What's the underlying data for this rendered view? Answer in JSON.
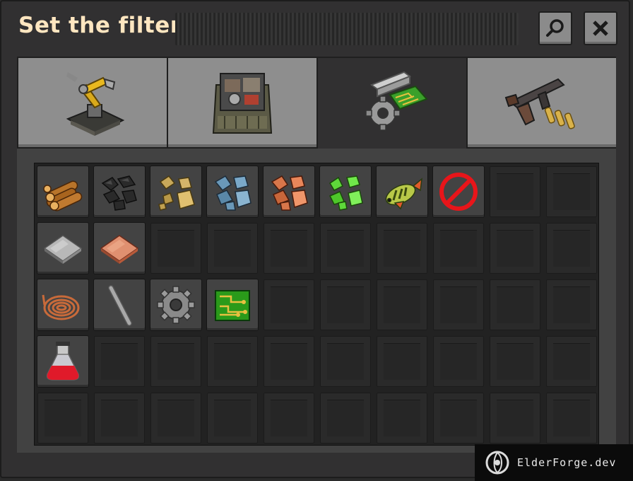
{
  "window": {
    "title": "Set the filter"
  },
  "toolbar": {
    "search_icon": "search-icon",
    "close_icon": "close-icon"
  },
  "tabs": [
    {
      "icon": "logistics-inserter-icon",
      "active": false
    },
    {
      "icon": "production-assembler-icon",
      "active": false
    },
    {
      "icon": "intermediate-products-icon",
      "active": true
    },
    {
      "icon": "combat-submachine-gun-icon",
      "active": false
    }
  ],
  "items": [
    [
      "wood",
      "coal",
      "stone",
      "iron-ore",
      "copper-ore",
      "uranium-ore",
      "raw-fish",
      "nothing"
    ],
    [
      "iron-plate",
      "copper-plate"
    ],
    [
      "copper-cable",
      "iron-stick",
      "iron-gear-wheel",
      "electronic-circuit"
    ],
    [
      "automation-science-pack"
    ]
  ],
  "grid": {
    "columns": 10,
    "rows": 5
  },
  "watermark": {
    "text": "ElderForge.dev"
  }
}
